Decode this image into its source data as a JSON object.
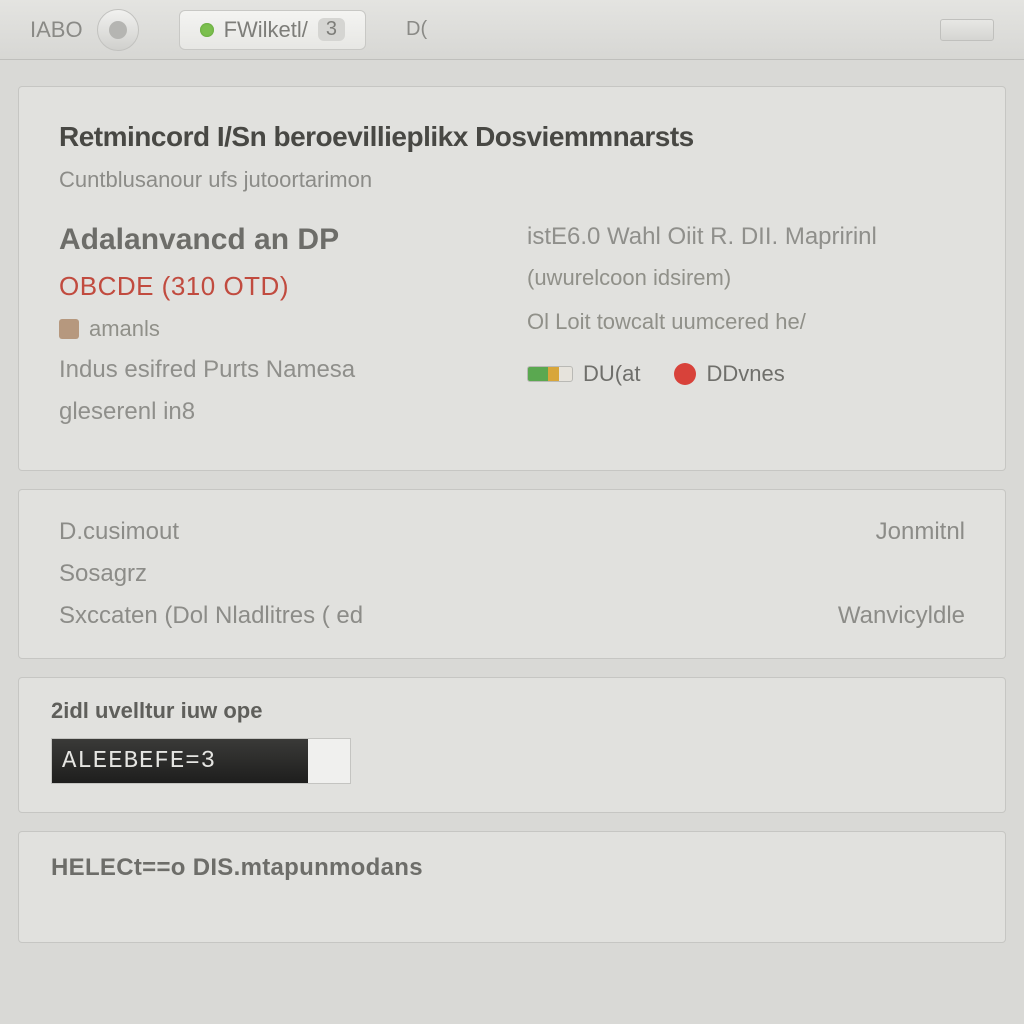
{
  "toolbar": {
    "left_label": "IABO",
    "tab_label": "FWilketl/",
    "tab_badge": "3",
    "right_small": "D("
  },
  "main": {
    "title": "Retmincord I/Sn beroevillieplikx Dosviemmnarsts",
    "subtitle": "Cuntblusanour ufs jutoortarimon",
    "left": {
      "advanced": "Adalanvancd an DP",
      "code": "OBCDE (310 OTD)",
      "small_tag": "amanls",
      "line4": "Indus esifred Purts Namesa",
      "line5": "gleserenl in8"
    },
    "right": {
      "line1": "istE6.0 Wahl Oiit R. DII. Mapririnl",
      "line2": "(uwurelcoon idsirem)",
      "line3": "Ol Loit towcalt uumcered he/",
      "status_a": "DU(at",
      "status_b": "DDvnes"
    }
  },
  "kv": {
    "rows": [
      {
        "left": "D.cusimout",
        "right": "Jonmitnl"
      },
      {
        "left": "Sosagrz",
        "right": ""
      },
      {
        "left": "Sxccaten (Dol Nladlitres ( ed",
        "right": "Wanvicyldle"
      }
    ]
  },
  "progress": {
    "label": "2idl uvelltur iuw ope",
    "text": "ALEEBEFE=3",
    "percent": 86
  },
  "footer": {
    "filename": "HELECt==o DIS.mtapunmodans"
  }
}
